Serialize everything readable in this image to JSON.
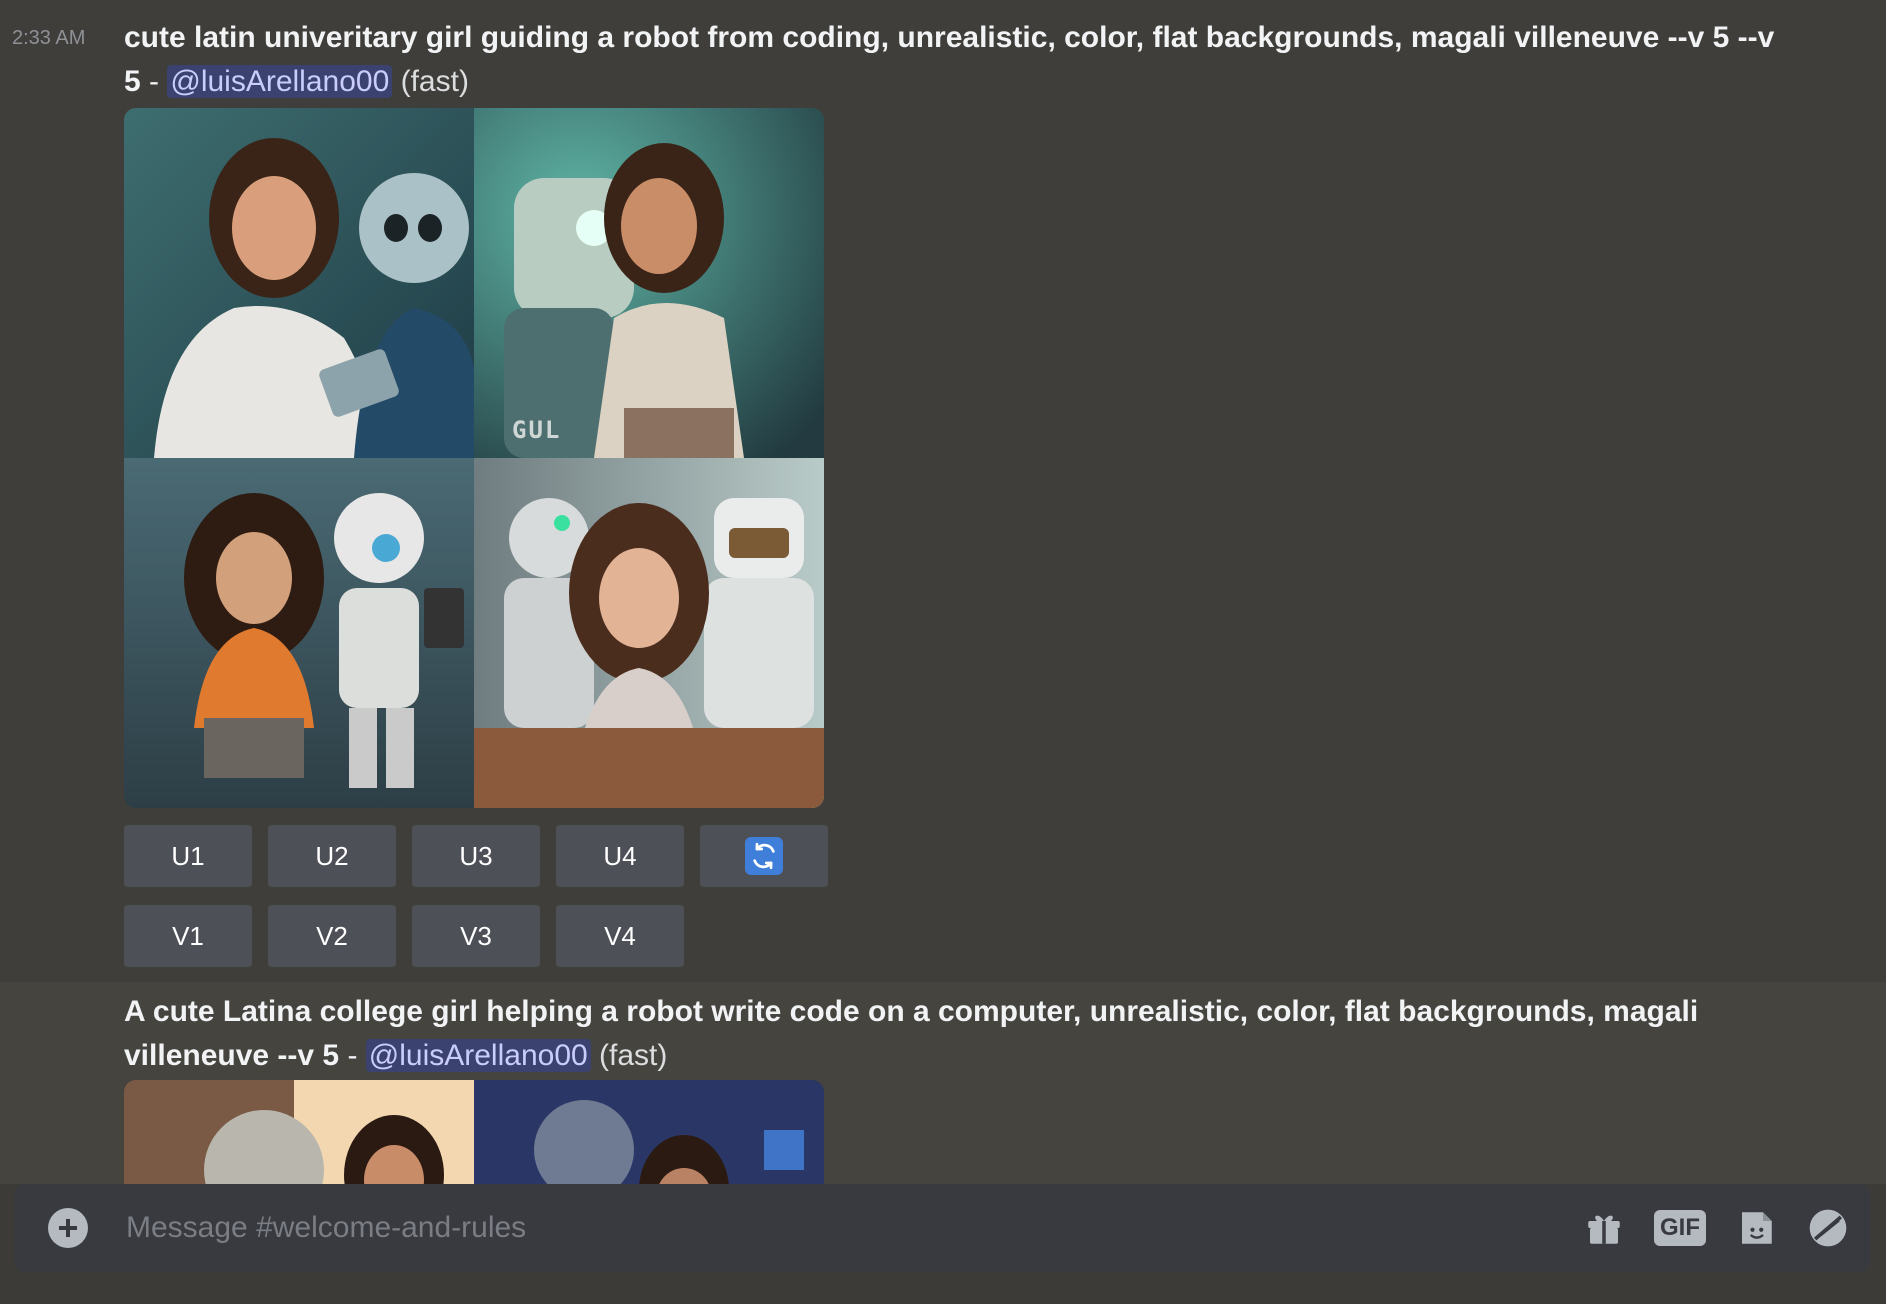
{
  "message1": {
    "timestamp": "2:33 AM",
    "prompt": "cute latin univeritary girl guiding a robot from coding, unrealistic, color, flat backgrounds, magali villeneuve --v 5 --v 5",
    "separator": " - ",
    "mention": "@luisArellano00",
    "mode": "(fast)",
    "image_caption": "GUL",
    "upscale_buttons": [
      "U1",
      "U2",
      "U3",
      "U4"
    ],
    "variation_buttons": [
      "V1",
      "V2",
      "V3",
      "V4"
    ],
    "reroll_icon": "refresh-icon"
  },
  "message2": {
    "prompt": "A cute Latina college girl helping a robot write code on a computer, unrealistic, color, flat backgrounds, magali villeneuve --v 5",
    "separator": " - ",
    "mention": "@luisArellano00",
    "mode": "(fast)"
  },
  "composer": {
    "placeholder": "Message #welcome-and-rules",
    "gif_label": "GIF",
    "icons": [
      "plus-circle-icon",
      "gift-icon",
      "gif-icon",
      "sticker-icon",
      "emoji-icon"
    ]
  },
  "colors": {
    "mention_bg": "#3c4270",
    "mention_text": "#c9cdfb",
    "button_bg": "#4e5058",
    "reroll_blue": "#3f7fd9",
    "composer_bg": "#383a40"
  }
}
